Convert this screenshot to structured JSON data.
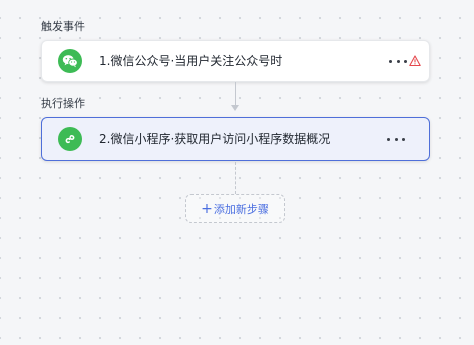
{
  "colors": {
    "wechat_green": "#3dbb55",
    "accent_blue": "#4f6fd9",
    "warning_red": "#e5484d"
  },
  "trigger_section": {
    "label": "触发事件",
    "card": {
      "title": "1.微信公众号·当用户关注公众号时",
      "icon": "wechat-icon",
      "more_icon": "more-horizontal-icon",
      "status_icon": "warning-triangle-icon"
    }
  },
  "action_section": {
    "label": "执行操作",
    "card": {
      "title": "2.微信小程序·获取用户访问小程序数据概况",
      "icon": "mini-program-icon",
      "more_icon": "more-horizontal-icon"
    }
  },
  "add_step": {
    "icon": "plus-icon",
    "plus_glyph": "+",
    "label": "添加新步骤"
  }
}
